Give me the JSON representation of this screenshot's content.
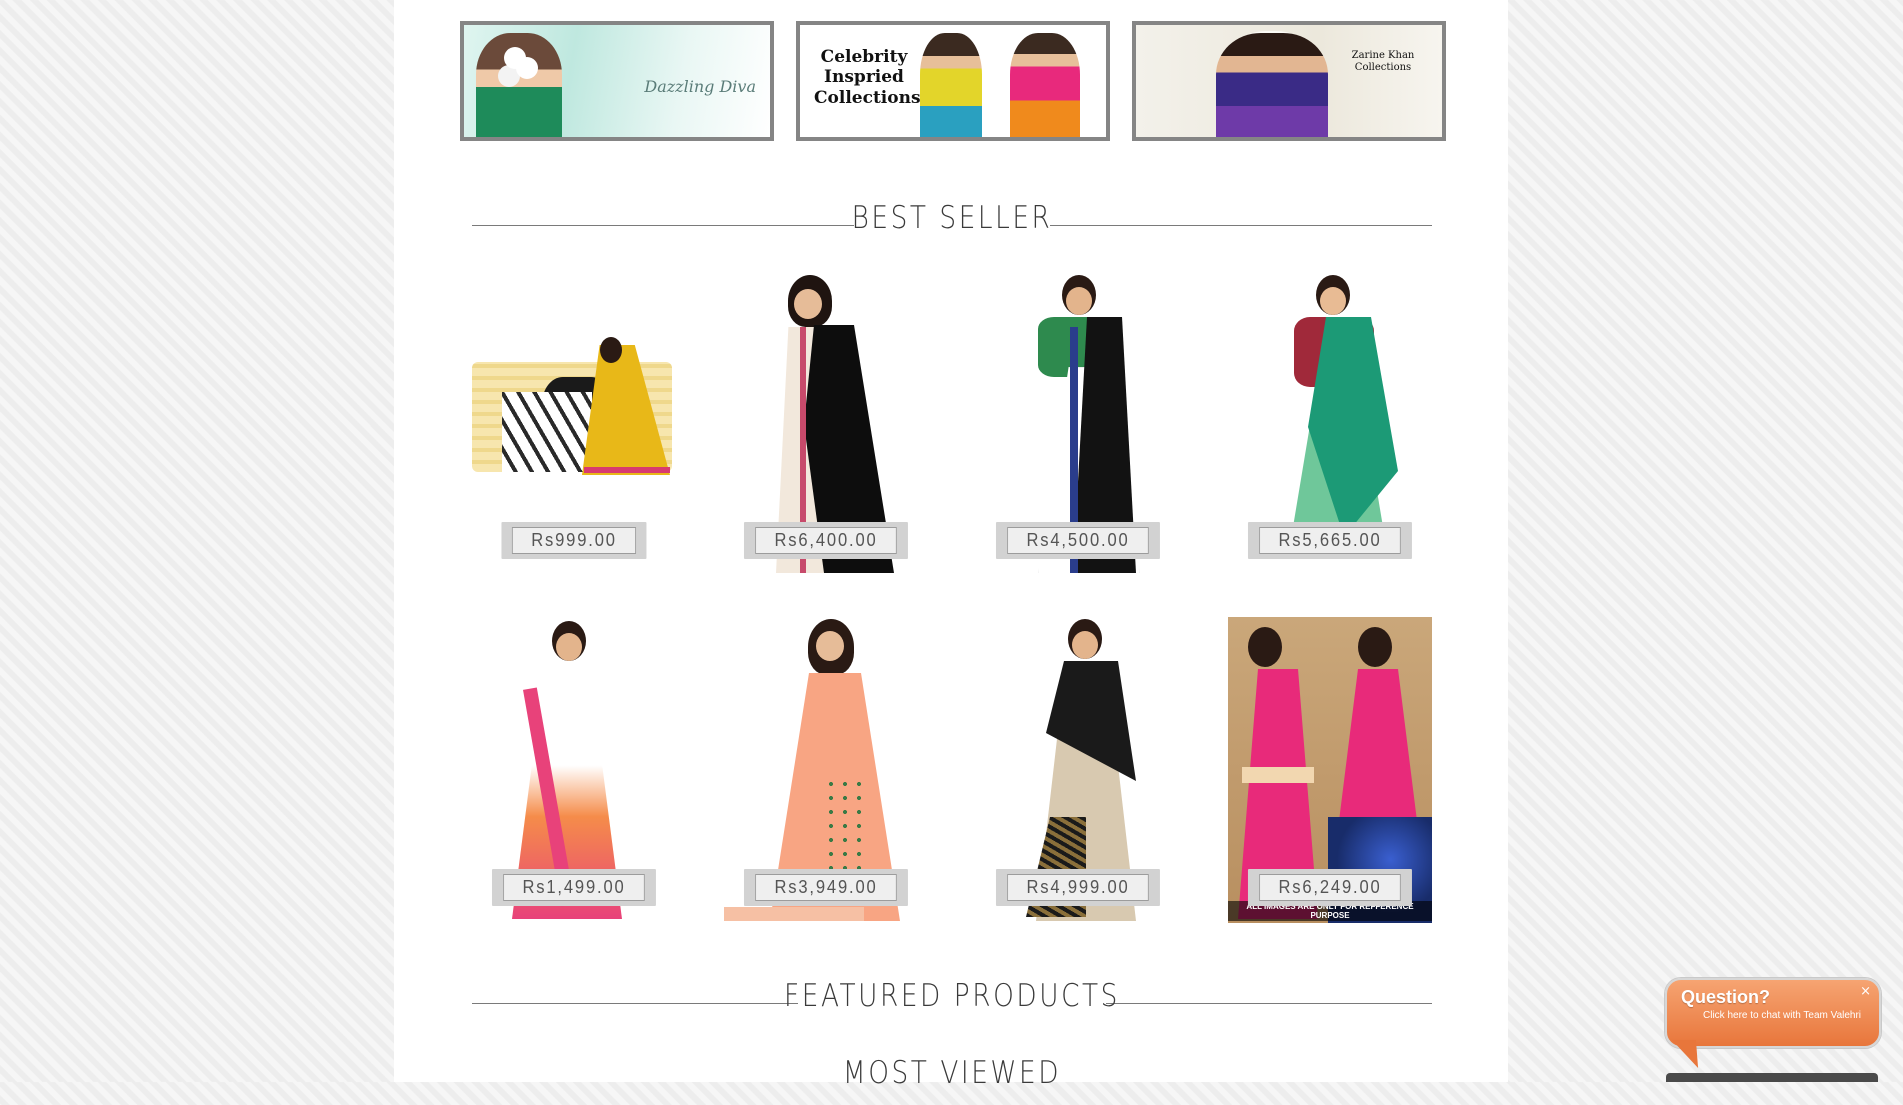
{
  "banners": [
    {
      "name": "Dazzling Diva",
      "text": "Dazzling Diva",
      "colors": [
        "#1e8b5a",
        "#c99",
        "#bfe8df"
      ]
    },
    {
      "name": "Celebrity Inspried Collections",
      "text": "Celebrity Inspried Collections"
    },
    {
      "name": "Zarine Khan Collections",
      "text": "Zarine Khan Collections"
    }
  ],
  "sections": {
    "best_seller": "BEST SELLER",
    "featured_products": "FEATURED PRODUCTS",
    "most_viewed": "MOST VIEWED"
  },
  "products": [
    {
      "price": "Rs999.00",
      "colors": [
        "#e8b818",
        "#ffffff",
        "#1a1a1a",
        "#d83a6f"
      ]
    },
    {
      "price": "Rs6,400.00",
      "colors": [
        "#0d0d0d",
        "#f2e8dc",
        "#c74a6b"
      ]
    },
    {
      "price": "Rs4,500.00",
      "colors": [
        "#121212",
        "#ffffff",
        "#2a3d8c",
        "#2e8a4e"
      ]
    },
    {
      "price": "Rs5,665.00",
      "colors": [
        "#1c9a76",
        "#6fc79a",
        "#a0293a"
      ]
    },
    {
      "price": "Rs1,499.00",
      "colors": [
        "#ffffff",
        "#f58c4a",
        "#e8427a"
      ]
    },
    {
      "price": "Rs3,949.00",
      "colors": [
        "#f8a583",
        "#f6c0a4",
        "#3a7a45"
      ]
    },
    {
      "price": "Rs4,999.00",
      "colors": [
        "#d8c9b0",
        "#1a1a1a",
        "#8a6f3a"
      ]
    },
    {
      "price": "Rs6,249.00",
      "colors": [
        "#e82a7a",
        "#f2d7b0",
        "#182c6a"
      ],
      "overlay": "ALL IMAGES ARE ONLY FOR REFFERENCE PURPOSE"
    }
  ],
  "chat": {
    "title": "Question?",
    "subtitle": "Click here to chat with Team Valehri",
    "close": "×"
  }
}
